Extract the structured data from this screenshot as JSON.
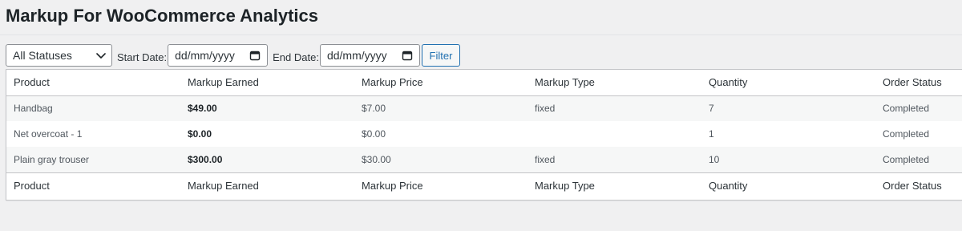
{
  "page": {
    "title": "Markup For WooCommerce Analytics"
  },
  "filters": {
    "status_select": {
      "selected": "All Statuses"
    },
    "start_date": {
      "label": "Start Date:",
      "value": "dd/mm/yyyy"
    },
    "end_date": {
      "label": "End Date:",
      "value": "dd/mm/yyyy"
    },
    "filter_button": "Filter"
  },
  "table": {
    "columns": [
      "Product",
      "Markup Earned",
      "Markup Price",
      "Markup Type",
      "Quantity",
      "Order Status"
    ],
    "rows": [
      [
        "Handbag",
        "$49.00",
        "$7.00",
        "fixed",
        "7",
        "Completed"
      ],
      [
        "Net overcoat - 1",
        "$0.00",
        "$0.00",
        "",
        "1",
        "Completed"
      ],
      [
        "Plain gray trouser",
        "$300.00",
        "$30.00",
        "fixed",
        "10",
        "Completed"
      ]
    ]
  },
  "icons": {
    "dropdown": "chevron-down-icon",
    "date_picker": "calendar-icon"
  },
  "colors": {
    "accent": "#2271b1",
    "background": "#f0f0f1",
    "row_alt": "#f6f7f7",
    "border": "#c3c4c7"
  }
}
